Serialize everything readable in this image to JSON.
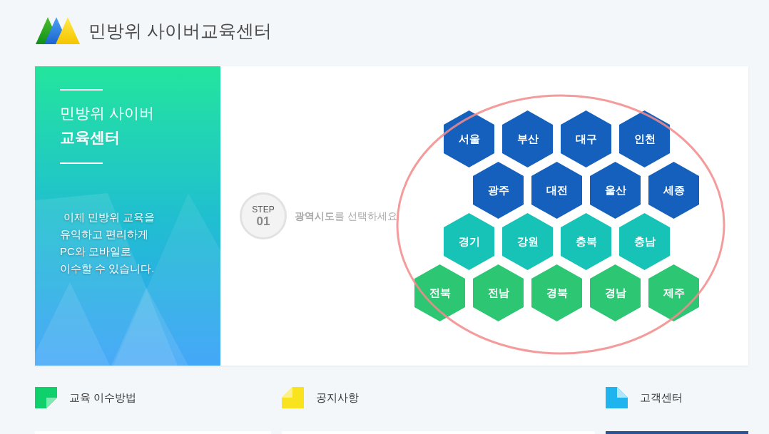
{
  "header": {
    "title": "민방위 사이버교육센터"
  },
  "intro": {
    "title_line_1": "민방위 사이버",
    "title_line_2": "교육센터",
    "description_lines": [
      "이제 민방위 교육을",
      "유익하고 편리하게",
      "PC와 모바일로",
      "이수할 수 있습니다."
    ]
  },
  "step": {
    "label": "STEP",
    "number": "01",
    "instruction": "**광역시도**를 선택하세요"
  },
  "region_rows": [
    {
      "regions": [
        {
          "label": "서울",
          "color": "#1560bd"
        },
        {
          "label": "부산",
          "color": "#1560bd"
        },
        {
          "label": "대구",
          "color": "#1560bd"
        },
        {
          "label": "인천",
          "color": "#1560bd"
        }
      ]
    },
    {
      "regions": [
        {
          "label": "광주",
          "color": "#1560bd"
        },
        {
          "label": "대전",
          "color": "#1560bd"
        },
        {
          "label": "울산",
          "color": "#1560bd"
        },
        {
          "label": "세종",
          "color": "#1560bd"
        }
      ]
    },
    {
      "regions": [
        {
          "label": "경기",
          "color": "#17c3b6"
        },
        {
          "label": "강원",
          "color": "#17c3b6"
        },
        {
          "label": "충북",
          "color": "#17c3b6"
        },
        {
          "label": "충남",
          "color": "#17c3b6"
        }
      ]
    },
    {
      "regions": [
        {
          "label": "전북",
          "color": "#2dc673"
        },
        {
          "label": "전남",
          "color": "#2dc673"
        },
        {
          "label": "경북",
          "color": "#2dc673"
        },
        {
          "label": "경남",
          "color": "#2dc673"
        },
        {
          "label": "제주",
          "color": "#2dc673"
        }
      ]
    }
  ],
  "links": [
    {
      "label": "교육 이수방법",
      "kind": "guide"
    },
    {
      "label": "공지사항",
      "kind": "notice"
    },
    {
      "label": "고객센터",
      "kind": "support"
    }
  ]
}
